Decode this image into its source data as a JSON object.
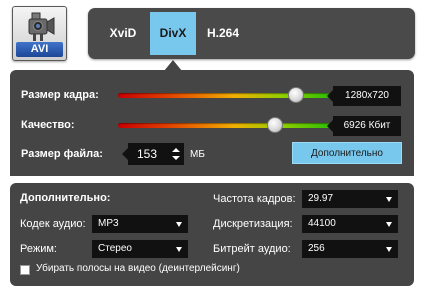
{
  "format_badge": "AVI",
  "codec_tabs": [
    "XviD",
    "DivX",
    "H.264"
  ],
  "selected_codec": "DivX",
  "main": {
    "frame_size_label": "Размер кадра:",
    "frame_size_value": "1280x720",
    "frame_size_level": 0.84,
    "quality_label": "Качество:",
    "quality_value": "6926 Кбит",
    "quality_level": 0.74,
    "file_size_label": "Размер файла:",
    "file_size_value": "153",
    "file_size_unit": "МБ",
    "advanced_button": "Дополнительно"
  },
  "advanced": {
    "title": "Дополнительно:",
    "audio_codec_label": "Кодек аудио:",
    "audio_codec_value": "MP3",
    "mode_label": "Режим:",
    "mode_value": "Стерео",
    "fps_label": "Частота кадров:",
    "fps_value": "29.97",
    "sample_rate_label": "Дискретизация:",
    "sample_rate_value": "44100",
    "audio_bitrate_label": "Битрейт аудио:",
    "audio_bitrate_value": "256",
    "deinterlace_label": "Убирать полосы на видео (деинтерлейсинг)",
    "deinterlace_checked": false
  },
  "colors": {
    "panel": "#454545",
    "accent": "#78c8ee",
    "field": "#111111"
  },
  "icons": [
    "video-camera-icon",
    "dropdown-arrow-icon",
    "spin-up-icon",
    "spin-down-icon"
  ]
}
